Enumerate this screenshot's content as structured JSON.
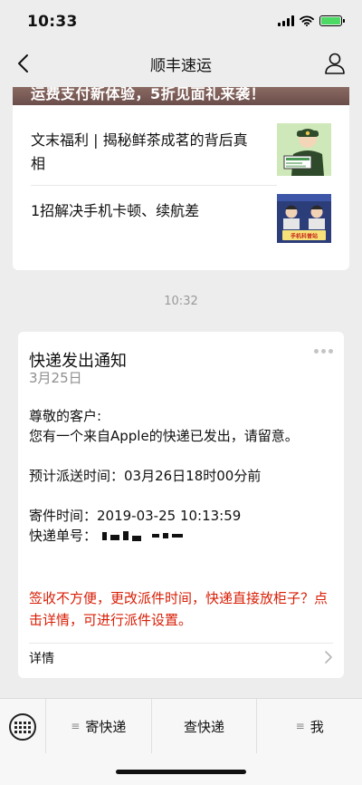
{
  "status_bar": {
    "time": "10:33"
  },
  "nav": {
    "title": "顺丰速运"
  },
  "article_card": {
    "banner_text": "运费支付新体验，5折见面礼来袭！",
    "items": [
      {
        "title": "文末福利 | 揭秘鲜茶成茗的背后真相"
      },
      {
        "title": "1招解决手机卡顿、续航差",
        "thumb_caption": "手机科普站"
      }
    ]
  },
  "timestamp": "10:32",
  "notice": {
    "title": "快递发出通知",
    "date": "3月25日",
    "greeting": "尊敬的客户:",
    "message": "您有一个来自Apple的快递已发出，请留意。",
    "delivery_time": "预计派送时间：03月26日18时00分前",
    "send_time": "寄件时间：2019-03-25 10:13:59",
    "tracking_label": "快递单号：",
    "warning": "签收不方便，更改派件时间，快递直接放柜子？点击详情，可进行派件设置。",
    "detail_label": "详情"
  },
  "menu": {
    "items": [
      {
        "label": "寄快递",
        "has_submenu": true
      },
      {
        "label": "查快递",
        "has_submenu": false
      },
      {
        "label": "我",
        "has_submenu": true
      }
    ]
  },
  "colors": {
    "warning": "#d81e06",
    "background": "#ededed",
    "battery": "#4cd964"
  },
  "icons": [
    "back-arrow-icon",
    "user-icon",
    "more-dots-icon",
    "chevron-right-icon",
    "keyboard-icon",
    "menu-lines-icon"
  ]
}
